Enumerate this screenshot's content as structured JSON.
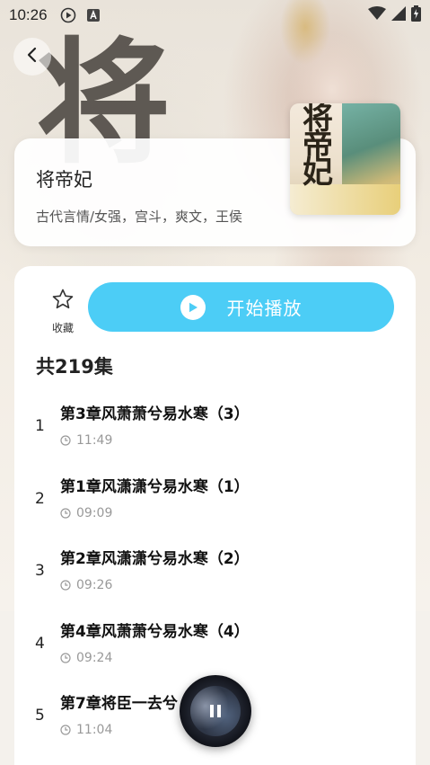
{
  "status_bar": {
    "time": "10:26",
    "icons": [
      "play-circle-icon",
      "text-a-icon"
    ],
    "right_icons": [
      "wifi-icon",
      "signal-icon",
      "battery-charging-icon"
    ]
  },
  "header": {
    "back_icon": "chevron-left-icon",
    "background_text": "将"
  },
  "book": {
    "title": "将帝妃",
    "tags": "古代言情/女强，宫斗，爽文，王侯",
    "cover_title": "将帝妃"
  },
  "actions": {
    "collect_label": "收藏",
    "collect_icon": "star-icon",
    "play_all_label": "开始播放",
    "play_icon": "play-icon"
  },
  "episodes": {
    "count_label": "共219集",
    "items": [
      {
        "index": "1",
        "title": "第3章风萧萧兮易水寒（3）",
        "duration": "11:49"
      },
      {
        "index": "2",
        "title": "第1章风潇潇兮易水寒（1）",
        "duration": "09:09"
      },
      {
        "index": "3",
        "title": "第2章风潇潇兮易水寒（2）",
        "duration": "09:26"
      },
      {
        "index": "4",
        "title": "第4章风萧萧兮易水寒（4）",
        "duration": "09:24"
      },
      {
        "index": "5",
        "title": "第7章将臣一去兮（1）",
        "duration": "11:04"
      }
    ]
  },
  "mini_player": {
    "state_icon": "pause-icon"
  },
  "colors": {
    "accent": "#4ccdf6",
    "muted_text": "#999999"
  }
}
